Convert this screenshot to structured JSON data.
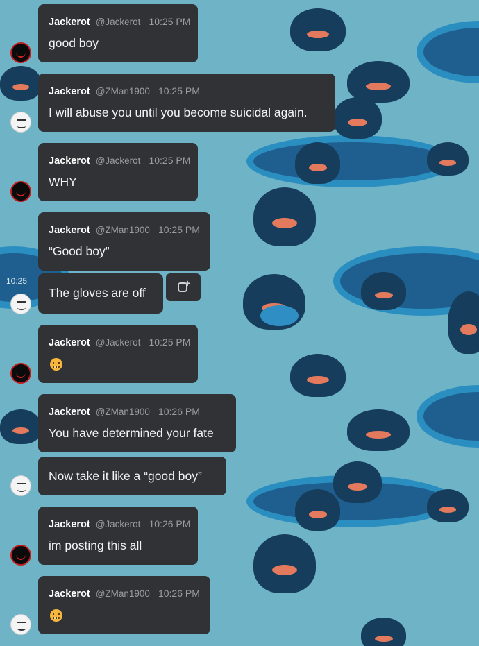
{
  "messages": [
    {
      "author": "Jackerot",
      "handle": "@Jackerot",
      "time": "10:25 PM",
      "text": "good boy"
    },
    {
      "author": "Jackerot",
      "handle": "@ZMan1900",
      "time": "10:25 PM",
      "text": "I will abuse you until you become suicidal again."
    },
    {
      "author": "Jackerot",
      "handle": "@Jackerot",
      "time": "10:25 PM",
      "text": "WHY"
    },
    {
      "author": "Jackerot",
      "handle": "@ZMan1900",
      "time": "10:25 PM",
      "text": "“Good boy”"
    },
    {
      "side_time": "10:25",
      "text": "The gloves are off"
    },
    {
      "author": "Jackerot",
      "handle": "@Jackerot",
      "time": "10:25 PM",
      "emoji": "grimacing-face-emoji"
    },
    {
      "author": "Jackerot",
      "handle": "@ZMan1900",
      "time": "10:26 PM",
      "text": "You have determined your fate"
    },
    {
      "text": "Now take it like a “good boy”"
    },
    {
      "author": "Jackerot",
      "handle": "@Jackerot",
      "time": "10:26 PM",
      "text": "im posting this all"
    },
    {
      "author": "Jackerot",
      "handle": "@ZMan1900",
      "time": "10:26 PM",
      "emoji": "grimacing-face-emoji"
    }
  ],
  "icons": {
    "add_reaction": "add-reaction-icon"
  },
  "colors": {
    "bubble": "#313236",
    "background": "#6fb3c7",
    "muted_text": "#9a9ca0"
  }
}
